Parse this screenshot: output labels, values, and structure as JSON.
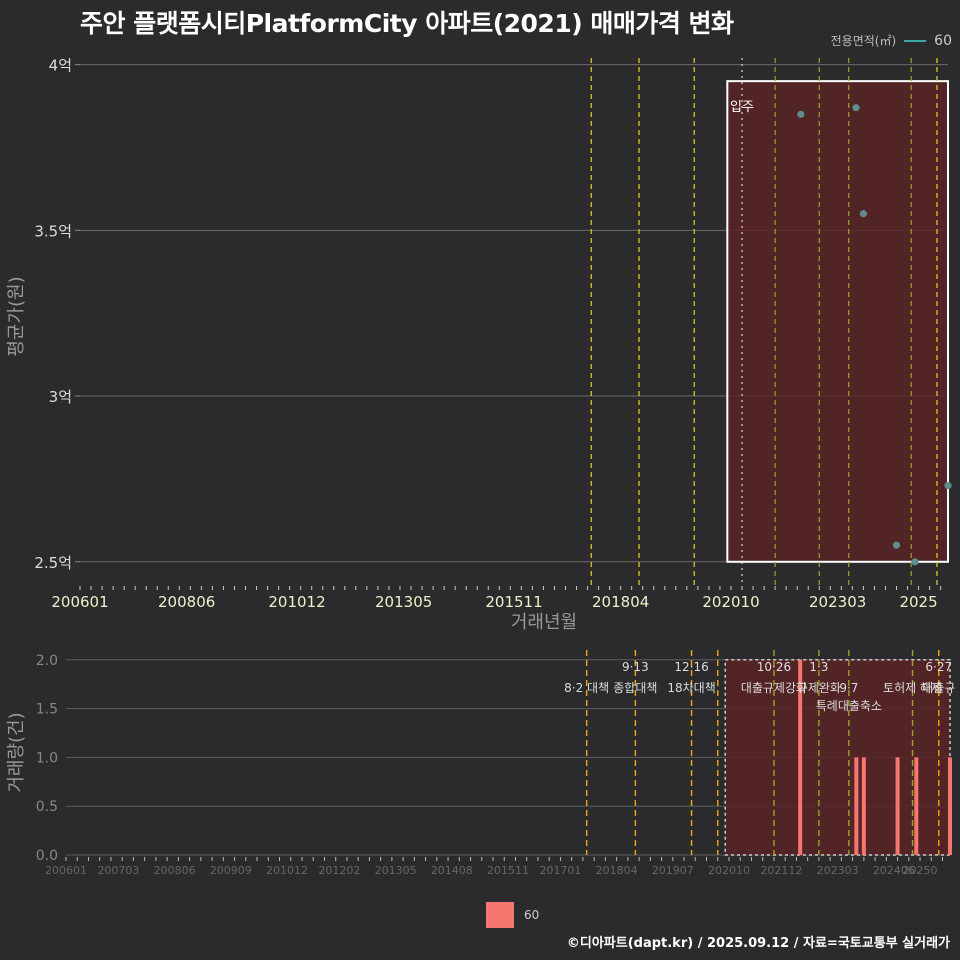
{
  "title": "주안 플랫폼시티PlatformCity 아파트(2021) 매매가격 변화",
  "footer": "©디아파트(dapt.kr) / 2025.09.12 / 자료=국토교통부 실거래가",
  "colors": {
    "background": "#2b2b2d",
    "point": "#5f8c8c",
    "bar": "#f4776f",
    "highlight": "#5a2326",
    "policy_yellow": "#e6d31a",
    "policy_orange": "#f0a70f",
    "policy_olive": "#9aa52a"
  },
  "chart_data": [
    {
      "type": "scatter",
      "name": "price",
      "title": "주안 플랫폼시티PlatformCity 아파트(2021) 매매가격 변화",
      "xlabel": "거래년월",
      "ylabel": "평균가(원)",
      "legend_title": "전용면적(㎡)",
      "legend_entries": [
        "60"
      ],
      "legend_placement": "top-right",
      "x_ticks": [
        "200601",
        "200806",
        "201012",
        "201305",
        "201511",
        "201804",
        "202010",
        "202303",
        "2025"
      ],
      "y_ticks": [
        "2.5억",
        "3억",
        "3.5억",
        "4억"
      ],
      "ylim": [
        2.43,
        4.05
      ],
      "xlim": [
        "2006-01",
        "2025-09"
      ],
      "grid": true,
      "annotations": [
        {
          "text": "입주",
          "x": "2021-01"
        }
      ],
      "highlight_range": {
        "from": "2020-09",
        "to": "2025-09",
        "ymin": 2.5,
        "ymax": 3.95
      },
      "policy_lines": [
        {
          "x": "2017-08",
          "color": "yellow"
        },
        {
          "x": "2018-09",
          "color": "yellow"
        },
        {
          "x": "2019-12",
          "color": "yellow"
        },
        {
          "x": "2021-01",
          "color": "white"
        },
        {
          "x": "2021-10",
          "color": "olive"
        },
        {
          "x": "2022-10",
          "color": "olive"
        },
        {
          "x": "2023-06",
          "color": "olive"
        },
        {
          "x": "2024-11",
          "color": "olive"
        },
        {
          "x": "2025-06",
          "color": "yellow"
        }
      ],
      "series": [
        {
          "name": "60",
          "points": [
            {
              "x": "2022-05",
              "y": 3.85
            },
            {
              "x": "2023-08",
              "y": 3.87
            },
            {
              "x": "2023-10",
              "y": 3.55
            },
            {
              "x": "2024-07",
              "y": 2.55
            },
            {
              "x": "2024-12",
              "y": 2.5
            },
            {
              "x": "2025-09",
              "y": 2.73
            }
          ]
        }
      ]
    },
    {
      "type": "bar",
      "name": "volume",
      "ylabel": "거래량(건)",
      "x_ticks": [
        "200601",
        "200703",
        "200806",
        "200909",
        "201012",
        "201202",
        "201305",
        "201408",
        "201511",
        "201701",
        "201804",
        "201907",
        "202010",
        "202112",
        "202303",
        "202406",
        "20250"
      ],
      "y_ticks": [
        "0.0",
        "0.5",
        "1.0",
        "1.5",
        "2.0"
      ],
      "ylim": [
        0,
        2.1
      ],
      "xlim": [
        "2006-01",
        "2025-09"
      ],
      "legend_entries": [
        "60"
      ],
      "legend_placement": "bottom",
      "highlight_range": {
        "from": "2020-09",
        "to": "2025-09",
        "ymin": 0,
        "ymax": 2
      },
      "policy_lines": [
        {
          "x": "2017-08",
          "label_top": "",
          "label": "8·2 대책",
          "color": "orange"
        },
        {
          "x": "2018-09",
          "label_top": "9·13",
          "label": "종합대책",
          "color": "orange"
        },
        {
          "x": "2019-12",
          "label_top": "12·16",
          "label": "18차대책",
          "color": "orange"
        },
        {
          "x": "2020-07",
          "label_top": "",
          "label": "",
          "color": "orange"
        },
        {
          "x": "2021-10",
          "label_top": "10·26",
          "label": "대출규제강화",
          "color": "olive"
        },
        {
          "x": "2022-10",
          "label_top": "1·3",
          "label": "규제완화",
          "color": "olive"
        },
        {
          "x": "2023-06",
          "label_top": "",
          "label": "9·7",
          "color": "olive"
        },
        {
          "x": "2023-06",
          "label_top": "",
          "label": "특례대출축소",
          "color": "olive"
        },
        {
          "x": "2024-11",
          "label_top": "",
          "label": "토허제 해제",
          "color": "olive"
        },
        {
          "x": "2025-06",
          "label_top": "6·27",
          "label": "대출규",
          "color": "orange"
        }
      ],
      "series": [
        {
          "name": "60",
          "points": [
            {
              "x": "2022-05",
              "y": 2
            },
            {
              "x": "2023-08",
              "y": 1
            },
            {
              "x": "2023-10",
              "y": 1
            },
            {
              "x": "2024-07",
              "y": 1
            },
            {
              "x": "2024-12",
              "y": 1
            },
            {
              "x": "2025-09",
              "y": 1
            }
          ]
        }
      ]
    }
  ]
}
